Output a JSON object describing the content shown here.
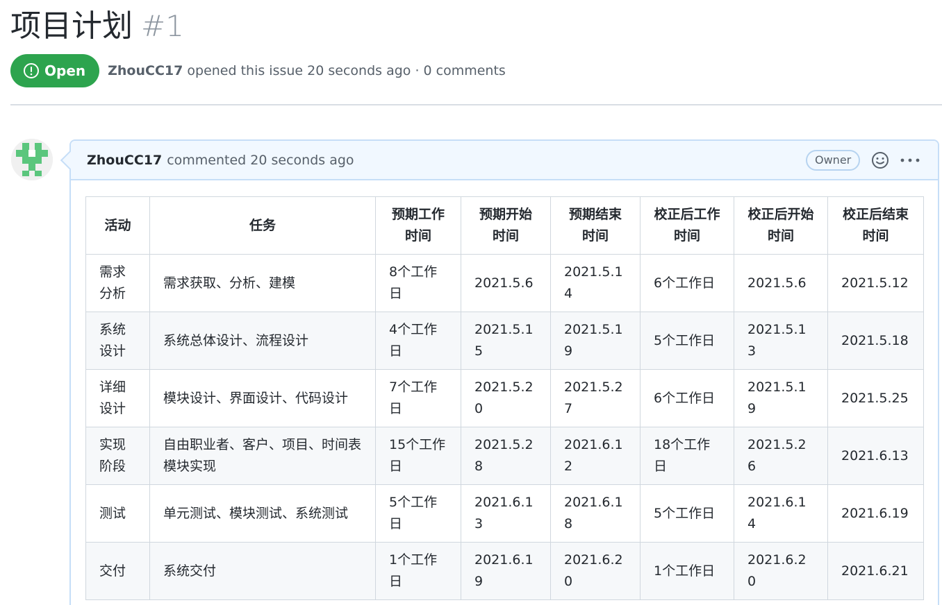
{
  "issue": {
    "title": "项目计划",
    "number": "#1",
    "state": "Open",
    "author": "ZhouCC17",
    "meta": "opened this issue 20 seconds ago · 0 comments"
  },
  "comment": {
    "author": "ZhouCC17",
    "action": "commented 20 seconds ago",
    "role_badge": "Owner",
    "avatar_color": "#5bc67d"
  },
  "colors": {
    "open_badge": "#2da44e",
    "comment_header_bg": "#f1f8ff",
    "comment_border": "#c6def7"
  },
  "table": {
    "headers": [
      "活动",
      "任务",
      "预期工作时间",
      "预期开始时间",
      "预期结束时间",
      "校正后工作时间",
      "校正后开始时间",
      "校正后结束时间"
    ],
    "rows": [
      [
        "需求分析",
        "需求获取、分析、建模",
        "8个工作日",
        "2021.5.6",
        "2021.5.14",
        "6个工作日",
        "2021.5.6",
        "2021.5.12"
      ],
      [
        "系统设计",
        "系统总体设计、流程设计",
        "4个工作日",
        "2021.5.15",
        "2021.5.19",
        "5个工作日",
        "2021.5.13",
        "2021.5.18"
      ],
      [
        "详细设计",
        "模块设计、界面设计、代码设计",
        "7个工作日",
        "2021.5.20",
        "2021.5.27",
        "6个工作日",
        "2021.5.19",
        "2021.5.25"
      ],
      [
        "实现阶段",
        "自由职业者、客户、项目、时间表模块实现",
        "15个工作日",
        "2021.5.28",
        "2021.6.12",
        "18个工作日",
        "2021.5.26",
        "2021.6.13"
      ],
      [
        "测试",
        "单元测试、模块测试、系统测试",
        "5个工作日",
        "2021.6.13",
        "2021.6.18",
        "5个工作日",
        "2021.6.14",
        "2021.6.19"
      ],
      [
        "交付",
        "系统交付",
        "1个工作日",
        "2021.6.19",
        "2021.6.20",
        "1个工作日",
        "2021.6.20",
        "2021.6.21"
      ]
    ]
  }
}
